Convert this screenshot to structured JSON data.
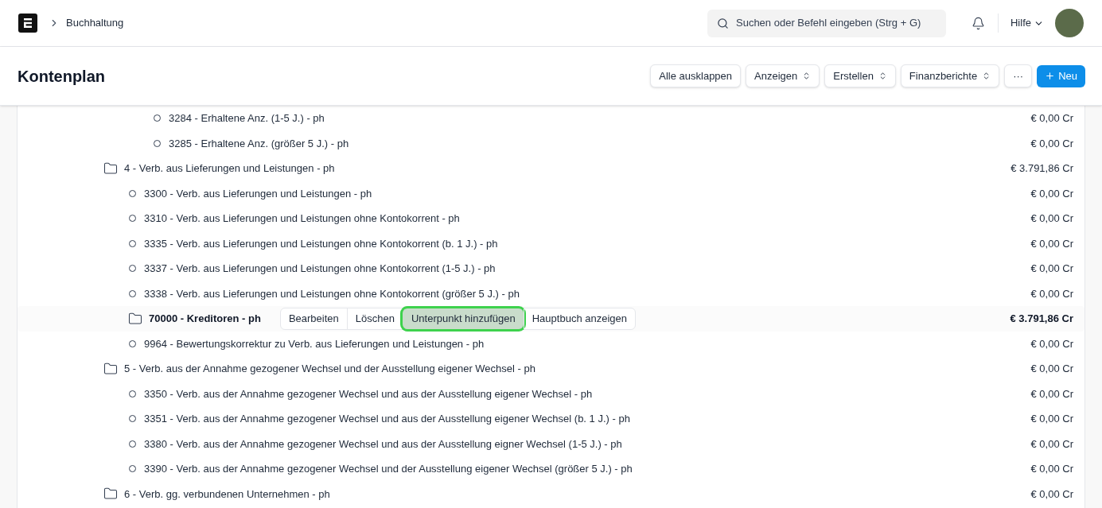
{
  "navbar": {
    "breadcrumb": "Buchhaltung",
    "search": {
      "placeholder": "Suchen oder Befehl eingeben (Strg + G)"
    },
    "help": "Hilfe"
  },
  "page": {
    "title": "Kontenplan",
    "actions": [
      {
        "label": "Alle ausklappen",
        "kind": "plain"
      },
      {
        "label": "Anzeigen",
        "kind": "dropdown"
      },
      {
        "label": "Erstellen",
        "kind": "dropdown"
      },
      {
        "label": "Finanzberichte",
        "kind": "dropdown"
      },
      {
        "label": "···",
        "kind": "more"
      },
      {
        "label": "Neu",
        "kind": "primary"
      }
    ]
  },
  "node_actions": [
    {
      "label": "Bearbeiten",
      "focused": false
    },
    {
      "label": "Löschen",
      "focused": false
    },
    {
      "label": "Unterpunkt hinzufügen",
      "focused": true
    },
    {
      "label": "Hauptbuch anzeigen",
      "focused": false
    }
  ],
  "accounts": [
    {
      "children": [
        {
          "children": [
            {
              "kind": "ledger",
              "label": "3284 - Erhaltene Anz. (1-5 J.) - ph",
              "balance": "€ 0,00 Cr",
              "selected": false
            },
            {
              "kind": "ledger",
              "label": "3285 - Erhaltene Anz. (größer 5 J.) - ph",
              "balance": "€ 0,00 Cr",
              "selected": false
            }
          ]
        }
      ]
    },
    {
      "kind": "group",
      "label": "4 - Verb. aus Lieferungen und Leistungen - ph",
      "balance": "€ 3.791,86 Cr",
      "selected": false,
      "children": [
        {
          "kind": "ledger",
          "label": "3300 - Verb. aus Lieferungen und Leistungen - ph",
          "balance": "€ 0,00 Cr",
          "selected": false
        },
        {
          "kind": "ledger",
          "label": "3310 - Verb. aus Lieferungen und Leistungen ohne Kontokorrent - ph",
          "balance": "€ 0,00 Cr",
          "selected": false
        },
        {
          "kind": "ledger",
          "label": "3335 - Verb. aus Lieferungen und Leistungen ohne Kontokorrent (b. 1 J.) - ph",
          "balance": "€ 0,00 Cr",
          "selected": false
        },
        {
          "kind": "ledger",
          "label": "3337 - Verb. aus Lieferungen und Leistungen ohne Kontokorrent (1-5 J.) - ph",
          "balance": "€ 0,00 Cr",
          "selected": false
        },
        {
          "kind": "ledger",
          "label": "3338 - Verb. aus Lieferungen und Leistungen ohne Kontokorrent (größer 5 J.) - ph",
          "balance": "€ 0,00 Cr",
          "selected": false
        },
        {
          "kind": "group",
          "label": "70000 - Kreditoren - ph",
          "balance": "€ 3.791,86 Cr",
          "selected": true
        },
        {
          "kind": "ledger",
          "label": "9964 - Bewertungskorrektur zu Verb. aus Lieferungen und Leistungen - ph",
          "balance": "€ 0,00 Cr",
          "selected": false
        }
      ]
    },
    {
      "kind": "group",
      "label": "5 - Verb. aus der Annahme gezogener Wechsel und der Ausstellung eigener Wechsel - ph",
      "balance": "€ 0,00 Cr",
      "selected": false,
      "children": [
        {
          "kind": "ledger",
          "label": "3350 - Verb. aus der Annahme gezogener Wechsel und aus der Ausstellung eigener Wechsel - ph",
          "balance": "€ 0,00 Cr",
          "selected": false
        },
        {
          "kind": "ledger",
          "label": "3351 - Verb. aus der Annahme gezogener Wechsel und aus der Ausstellung eigener Wechsel (b. 1 J.) - ph",
          "balance": "€ 0,00 Cr",
          "selected": false
        },
        {
          "kind": "ledger",
          "label": "3380 - Verb. aus der Annahme gezogener Wechsel und aus der Ausstellung eigner Wechsel (1-5 J.) - ph",
          "balance": "€ 0,00 Cr",
          "selected": false
        },
        {
          "kind": "ledger",
          "label": "3390 - Verb. aus der Annahme gezogener Wechsel und der Ausstellung eigener Wechsel (größer 5 J.) - ph",
          "balance": "€ 0,00 Cr",
          "selected": false
        }
      ]
    },
    {
      "kind": "group",
      "label": "6 - Verb. gg. verbundenen Unternehmen - ph",
      "balance": "€ 0,00 Cr",
      "selected": false
    }
  ]
}
